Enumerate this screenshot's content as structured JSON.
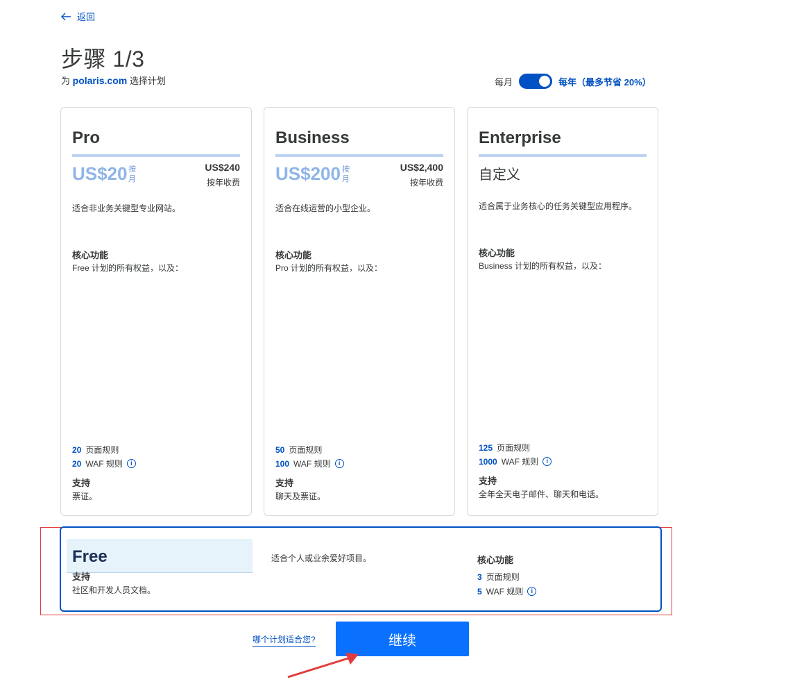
{
  "back": {
    "label": "返回"
  },
  "header": {
    "step_title": "步骤 1/3",
    "subtitle_prefix": "为",
    "domain": "polaris.com",
    "subtitle_suffix": "选择计划"
  },
  "billing": {
    "monthly_label": "每月",
    "yearly_label": "每年（最多节省 20%）",
    "yearly_selected": true
  },
  "plans": [
    {
      "name": "Pro",
      "price": "US$20",
      "per_unit": "按月",
      "yearly_price": "US$240",
      "yearly_label": "按年收费",
      "description": "适合非业务关键型专业网站。",
      "core_heading": "核心功能",
      "core_text": "Free 计划的所有权益，以及：",
      "page_rules_count": "20",
      "page_rules_label": "页面规则",
      "waf_rules_count": "20",
      "waf_rules_label": "WAF 规则",
      "support_heading": "支持",
      "support_text": "票证。"
    },
    {
      "name": "Business",
      "price": "US$200",
      "per_unit": "按月",
      "yearly_price": "US$2,400",
      "yearly_label": "按年收费",
      "description": "适合在线运营的小型企业。",
      "core_heading": "核心功能",
      "core_text": "Pro 计划的所有权益，以及：",
      "page_rules_count": "50",
      "page_rules_label": "页面规则",
      "waf_rules_count": "100",
      "waf_rules_label": "WAF 规则",
      "support_heading": "支持",
      "support_text": "聊天及票证。"
    },
    {
      "name": "Enterprise",
      "custom_price": "自定义",
      "description": "适合属于业务核心的任务关键型应用程序。",
      "core_heading": "核心功能",
      "core_text": "Business 计划的所有权益，以及：",
      "page_rules_count": "125",
      "page_rules_label": "页面规则",
      "waf_rules_count": "1000",
      "waf_rules_label": "WAF 规则",
      "support_heading": "支持",
      "support_text": "全年全天电子邮件、聊天和电话。"
    }
  ],
  "free_plan": {
    "name": "Free",
    "support_heading": "支持",
    "support_text": "社区和开发人员文档。",
    "description": "适合个人或业余爱好项目。",
    "core_heading": "核心功能",
    "page_rules_count": "3",
    "page_rules_label": "页面规则",
    "waf_rules_count": "5",
    "waf_rules_label": "WAF 规则"
  },
  "footer": {
    "which_plan_link": "哪个计划适合您?",
    "continue_label": "继续"
  },
  "colors": {
    "accent": "#0051c3",
    "continue_button": "#0a71ff",
    "annotation_red": "#e23b3b"
  }
}
